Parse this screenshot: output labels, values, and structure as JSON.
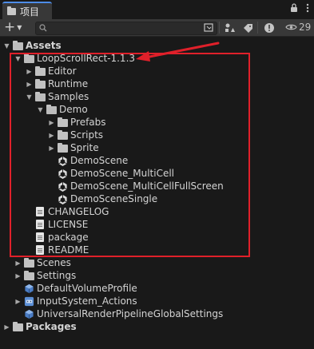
{
  "window": {
    "tab_title": "项目",
    "lock_icon": "lock-icon",
    "menu_icon": "kebab-menu-icon"
  },
  "toolbar": {
    "add_label": "+",
    "search_value": "",
    "hidden_count": "29"
  },
  "colors": {
    "highlight_box": "#e0202a",
    "arrow": "#e0202a",
    "tab_accent": "#4d8ce8"
  },
  "tree": {
    "assets": "Assets",
    "loop_scroll": "LoopScrollRect-1.1.3",
    "editor": "Editor",
    "runtime": "Runtime",
    "samples": "Samples",
    "demo": "Demo",
    "prefabs": "Prefabs",
    "scripts": "Scripts",
    "sprite": "Sprite",
    "demo_scene": "DemoScene",
    "demo_scene_multicell": "DemoScene_MultiCell",
    "demo_scene_multicell_fullscreen": "DemoScene_MultiCellFullScreen",
    "demo_scene_single": "DemoSceneSingle",
    "changelog": "CHANGELOG",
    "license": "LICENSE",
    "package": "package",
    "readme": "README",
    "scenes": "Scenes",
    "settings": "Settings",
    "default_volume_profile": "DefaultVolumeProfile",
    "input_system_actions": "InputSystem_Actions",
    "urp_global_settings": "UniversalRenderPipelineGlobalSettings",
    "packages": "Packages"
  }
}
